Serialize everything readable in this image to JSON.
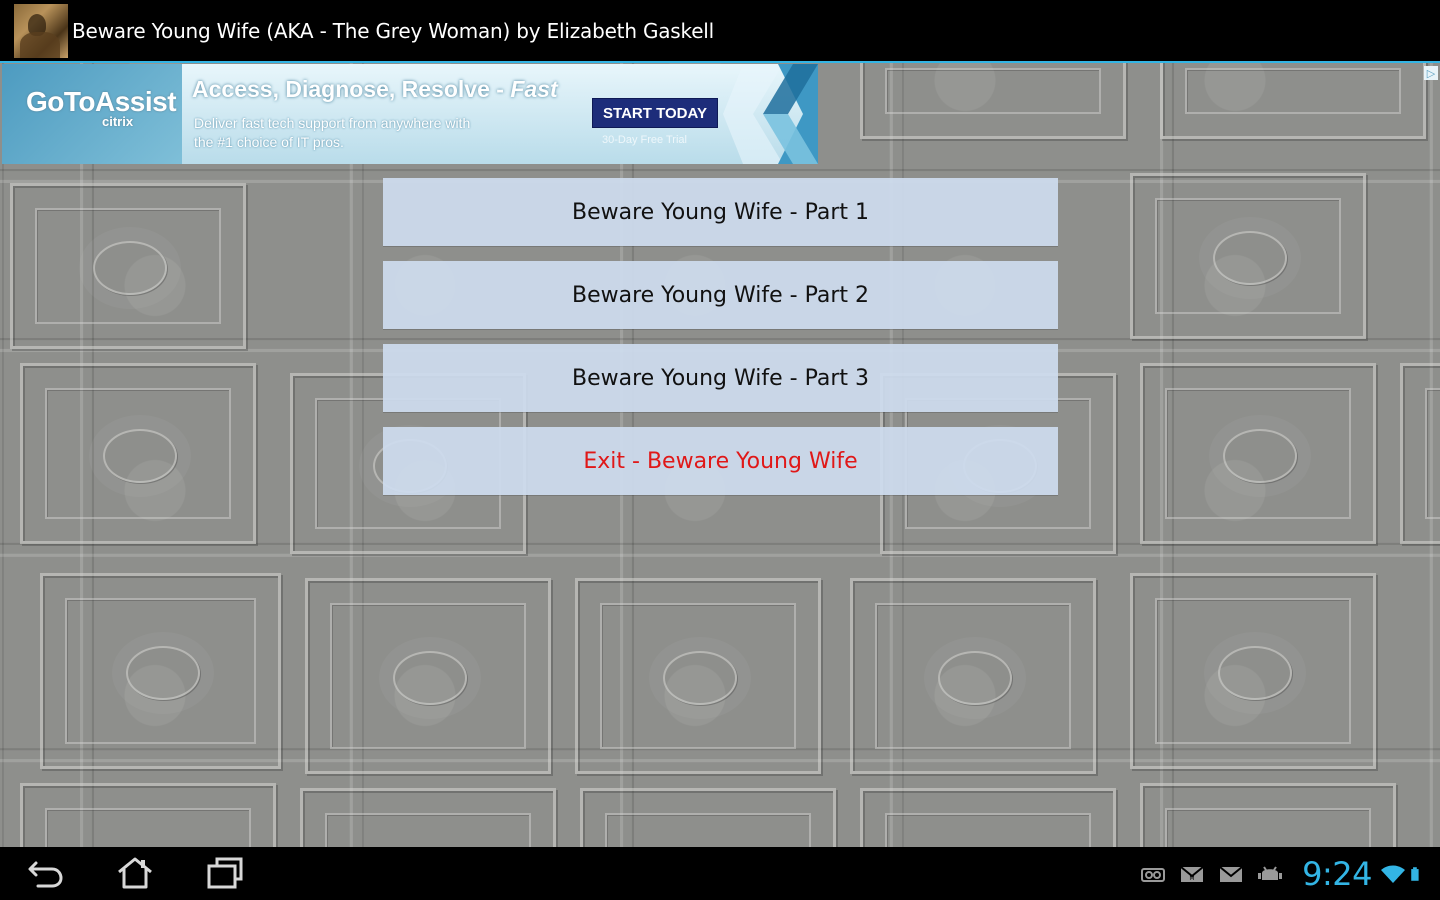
{
  "titlebar": {
    "title": "Beware Young Wife (AKA - The Grey Woman) by Elizabeth Gaskell",
    "icon": "book-cover-icon"
  },
  "ad": {
    "brand": "GoToAssist",
    "brand_sub": "citrix",
    "headline": "Access, Diagnose, Resolve - ",
    "headline_emphasis": "Fast",
    "body_line1": "Deliver fast tech support from anywhere with",
    "body_line2": "the #1 choice of IT pros.",
    "cta": "START TODAY",
    "trial": "30-Day Free Trial",
    "info_icon": "ad-info-icon"
  },
  "menu": {
    "items": [
      {
        "label": "Beware Young Wife - Part 1"
      },
      {
        "label": "Beware Young Wife - Part 2"
      },
      {
        "label": "Beware Young Wife - Part 3"
      },
      {
        "label": "Exit - Beware Young Wife"
      }
    ]
  },
  "navbar": {
    "back_icon": "back-icon",
    "home_icon": "home-icon",
    "recents_icon": "recent-apps-icon"
  },
  "statusbar": {
    "time": "9:24",
    "icons": [
      "voicemail-icon",
      "gmail-icon",
      "email-icon",
      "android-debug-icon",
      "wifi-icon",
      "battery-icon"
    ]
  },
  "colors": {
    "accent": "#33b5e5",
    "exit_text": "#e01818",
    "button_bg": "#cddcee",
    "cta_bg": "#1d2d7a"
  }
}
